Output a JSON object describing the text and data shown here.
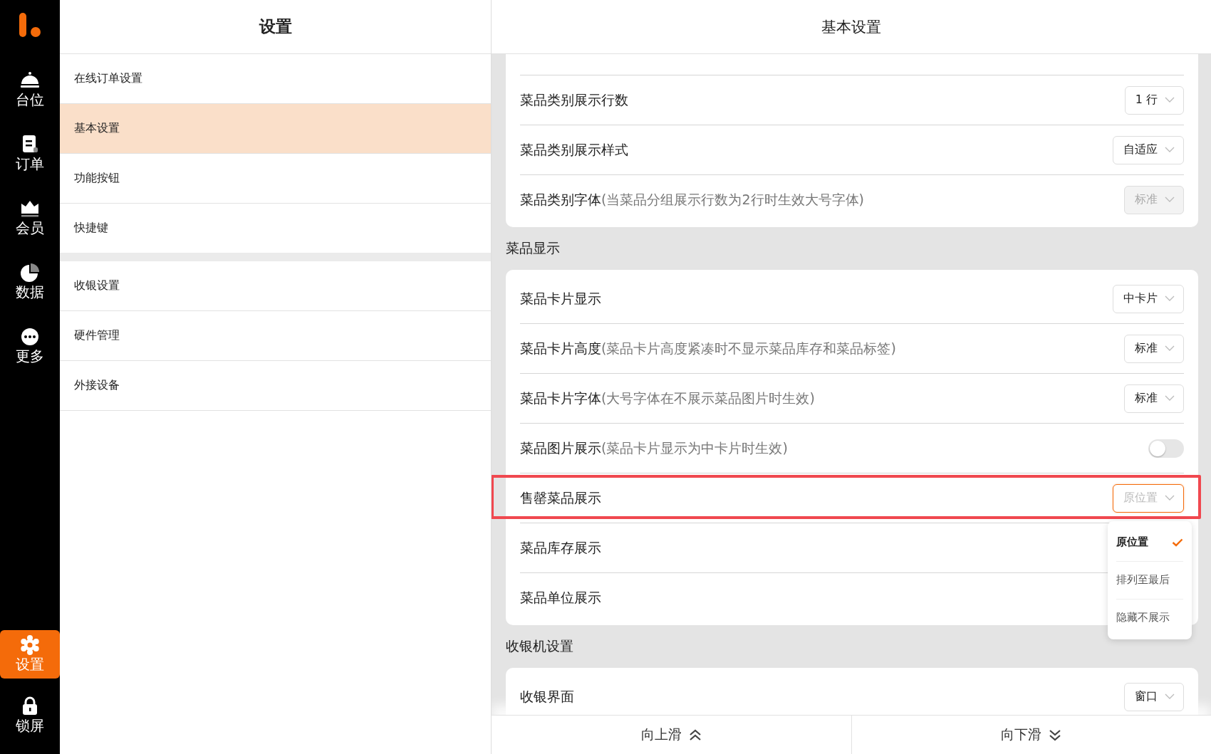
{
  "rail": {
    "items": [
      {
        "label": "台位",
        "selected": false
      },
      {
        "label": "订单",
        "selected": false
      },
      {
        "label": "会员",
        "selected": false
      },
      {
        "label": "数据",
        "selected": false
      },
      {
        "label": "更多",
        "selected": false
      },
      {
        "label": "设置",
        "selected": true
      },
      {
        "label": "锁屏",
        "selected": false
      }
    ]
  },
  "settings_menu": {
    "title": "设置",
    "groups": [
      [
        {
          "label": "在线订单设置",
          "selected": false
        },
        {
          "label": "基本设置",
          "selected": true
        },
        {
          "label": "功能按钮",
          "selected": false
        },
        {
          "label": "快捷键",
          "selected": false
        }
      ],
      [
        {
          "label": "收银设置",
          "selected": false
        },
        {
          "label": "硬件管理",
          "selected": false
        },
        {
          "label": "外接设备",
          "selected": false
        }
      ]
    ]
  },
  "panel": {
    "title": "基本设置",
    "sections": [
      {
        "rows": [
          {
            "label": "菜品类别展示行数",
            "kind": "select",
            "value": "1 行",
            "disabled": false
          },
          {
            "label": "菜品类别展示样式",
            "kind": "select",
            "value": "自适应",
            "disabled": false
          },
          {
            "label": "菜品类别字体",
            "note": "(当菜品分组展示行数为2行时生效大号字体)",
            "kind": "select",
            "value": "标准",
            "disabled": true
          }
        ]
      },
      {
        "title": "菜品显示",
        "rows": [
          {
            "label": "菜品卡片显示",
            "kind": "select",
            "value": "中卡片",
            "disabled": false
          },
          {
            "label": "菜品卡片高度",
            "note": "(菜品卡片高度紧凑时不显示菜品库存和菜品标签)",
            "kind": "select",
            "value": "标准",
            "disabled": false
          },
          {
            "label": "菜品卡片字体",
            "note": "(大号字体在不展示菜品图片时生效)",
            "kind": "select",
            "value": "标准",
            "disabled": false
          },
          {
            "label": "菜品图片展示",
            "note": "(菜品卡片显示为中卡片时生效)",
            "kind": "toggle",
            "on": false
          },
          {
            "label": "售罄菜品展示",
            "kind": "select",
            "value": "原位置",
            "disabled": false,
            "highlighted": true,
            "open": true,
            "options": [
              {
                "label": "原位置",
                "selected": true
              },
              {
                "label": "排列至最后",
                "selected": false
              },
              {
                "label": "隐藏不展示",
                "selected": false
              }
            ]
          },
          {
            "label": "菜品库存展示",
            "kind": "plain"
          },
          {
            "label": "菜品单位展示",
            "kind": "plain"
          }
        ]
      },
      {
        "title": "收银机设置",
        "rows": [
          {
            "label": "收银界面",
            "kind": "select",
            "value": "窗口",
            "disabled": false
          }
        ]
      }
    ]
  },
  "bottom_bar": {
    "buttons": [
      {
        "label": "向上滑"
      },
      {
        "label": "向下滑"
      }
    ]
  }
}
